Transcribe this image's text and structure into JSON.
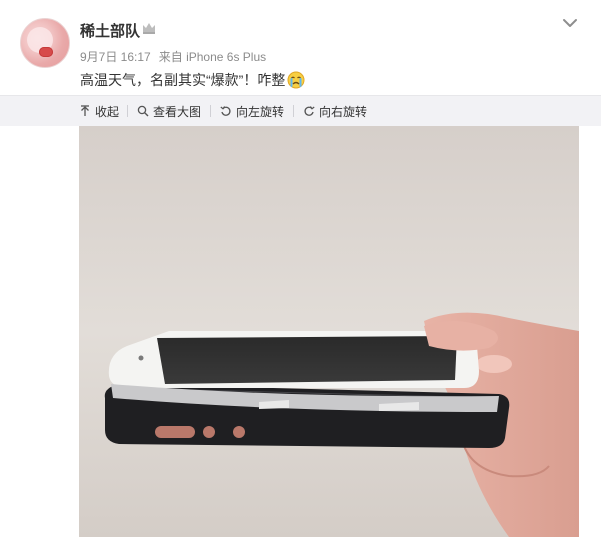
{
  "post": {
    "username": "稀土部队",
    "badge_icon": "crown-icon",
    "date": "9月7日 16:17",
    "source_prefix": "来自",
    "source_device": "iPhone 6s Plus",
    "text": "高温天气，名副其实“爆款”！咋整",
    "emoji_icon": "crying-face-icon"
  },
  "toolbar": {
    "collapse": "收起",
    "view_large": "查看大图",
    "rotate_left": "向左旋转",
    "rotate_right": "向右旋转"
  },
  "colors": {
    "toolbar_bg": "#f2f2f5",
    "meta_text": "#8b8b8b",
    "username_text": "#333333"
  },
  "photo": {
    "subject": "swollen-battery-iphone-photo"
  }
}
